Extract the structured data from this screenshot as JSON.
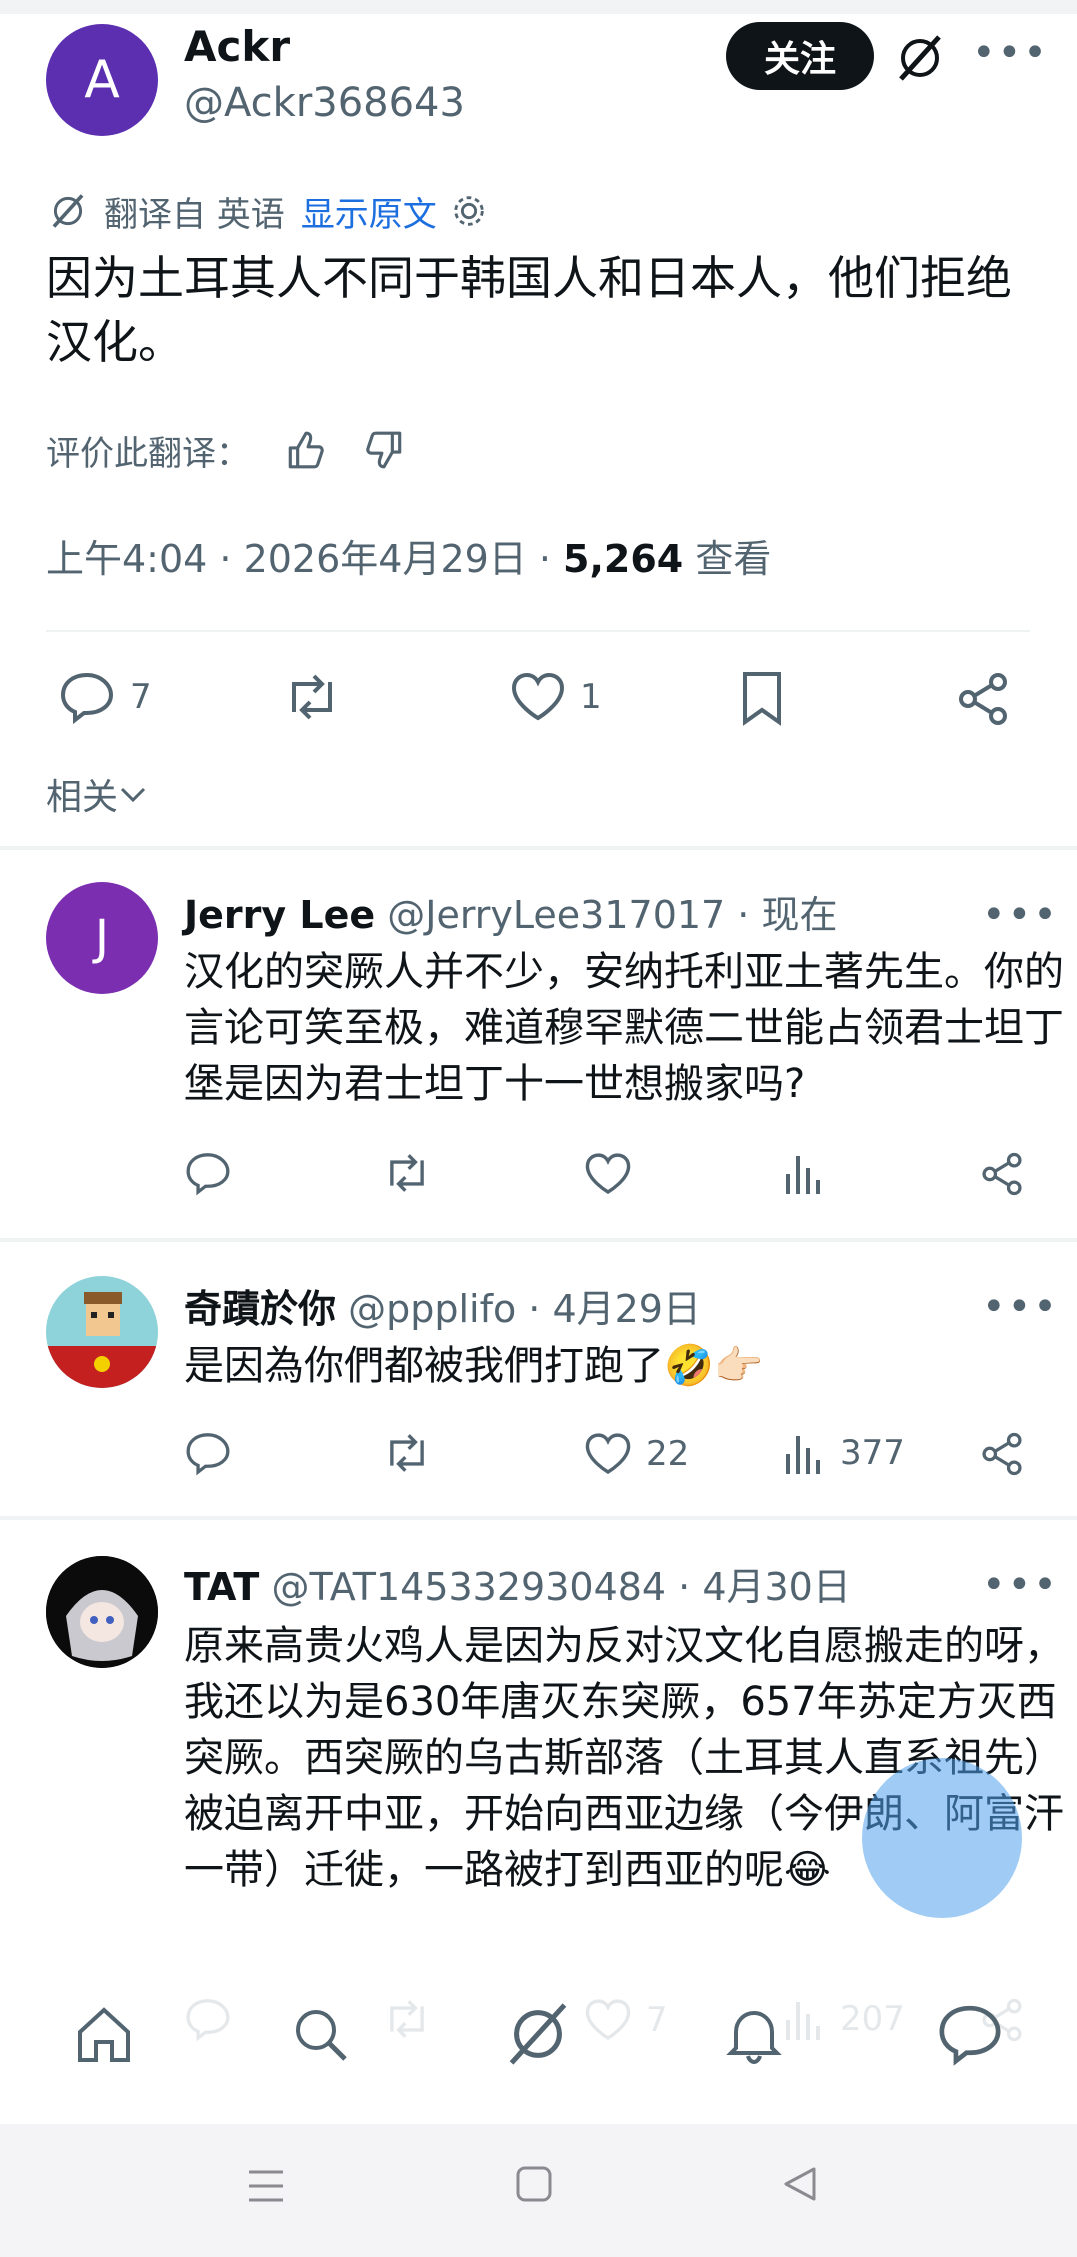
{
  "post": {
    "avatar_letter": "A",
    "name": "Ackr",
    "handle": "@Ackr368643",
    "follow_label": "关注",
    "translated_from": "翻译自 英语",
    "show_original": "显示原文",
    "text": "因为土耳其人不同于韩国人和日本人，他们拒绝汉化。",
    "rate_label": "评价此翻译：",
    "time": "上午4:04 · 2026年4月29日 · ",
    "views": "5,264",
    "views_label": " 查看",
    "replies": "7",
    "likes": "1",
    "related_label": "相关"
  },
  "replies": [
    {
      "avatar_letter": "J",
      "name": "Jerry Lee",
      "handle": "@JerryLee317017 · 现在",
      "text": "汉化的突厥人并不少，安纳托利亚土著先生。你的言论可笑至极，难道穆罕默德二世能占领君士坦丁堡是因为君士坦丁十一世想搬家吗?",
      "likes": "",
      "views": ""
    },
    {
      "name": "奇蹟於你",
      "handle": "@ppplifo · 4月29日",
      "text": "是因為你們都被我們打跑了🤣👉🏻",
      "likes": "22",
      "views": "377"
    },
    {
      "name": "TAT",
      "handle": "@TAT145332930484 · 4月30日",
      "text": "原来高贵火鸡人是因为反对汉文化自愿搬走的呀，我还以为是630年唐灭东突厥，657年苏定方灭西突厥。西突厥的乌古斯部落（土耳其人直系祖先）被迫离开中亚，开始向西亚边缘（今伊朗、阿富汗一带）迁徙，一路被打到西亚的呢😂",
      "likes": "7",
      "views": "207"
    }
  ],
  "colors": {
    "accent": "#1d6fe0",
    "text": "#0f1419",
    "muted": "#536471",
    "avatar_main": "#5b2fb0",
    "avatar_j": "#7b2fb0"
  }
}
